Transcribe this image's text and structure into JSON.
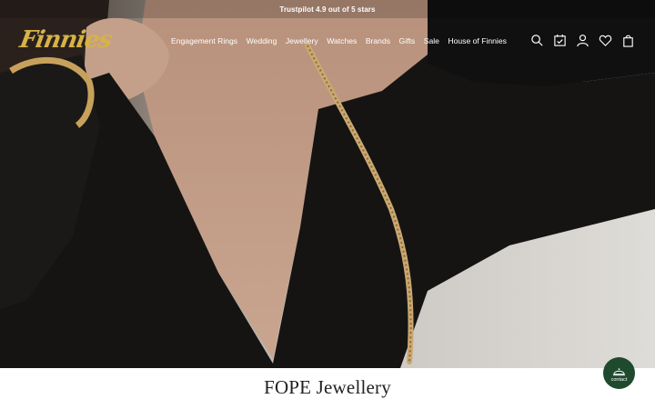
{
  "announcement": {
    "text": "Trustpilot 4.9 out of 5 stars"
  },
  "brand": {
    "logo_text": "Finnies",
    "accent_color": "#d7b247"
  },
  "nav": {
    "items": [
      {
        "label": "Engagement Rings"
      },
      {
        "label": "Wedding"
      },
      {
        "label": "Jewellery"
      },
      {
        "label": "Watches"
      },
      {
        "label": "Brands"
      },
      {
        "label": "Gifts"
      },
      {
        "label": "Sale"
      },
      {
        "label": "House of Finnies"
      }
    ]
  },
  "header_icons": [
    "search-icon",
    "calendar-icon",
    "account-icon",
    "wishlist-heart-icon",
    "bag-icon"
  ],
  "page": {
    "title": "FOPE Jewellery"
  },
  "contact": {
    "label": "contact",
    "color": "#1f4a2e"
  }
}
